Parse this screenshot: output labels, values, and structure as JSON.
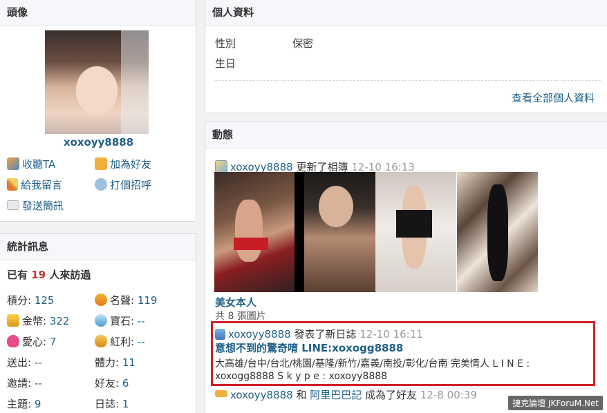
{
  "avatar_panel": {
    "title": "頭像",
    "username": "xoxoyy8888",
    "actions": [
      {
        "label": "收聽TA",
        "icon": "follow-icon"
      },
      {
        "label": "加為好友",
        "icon": "handshake-icon"
      },
      {
        "label": "給我留言",
        "icon": "pencil-icon"
      },
      {
        "label": "打個招呼",
        "icon": "chat-bubble-icon"
      },
      {
        "label": "發送簡訊",
        "icon": "envelope-icon"
      }
    ]
  },
  "stats_panel": {
    "title": "統計訊息",
    "visitors_prefix": "已有",
    "visitors_count": "19",
    "visitors_suffix": "人來訪過",
    "left": [
      {
        "label": "積分:",
        "value": "125",
        "icon": ""
      },
      {
        "label": "金幣:",
        "value": "322",
        "icon": "gold-coin-icon"
      },
      {
        "label": "愛心:",
        "value": "7",
        "icon": "heart-icon"
      },
      {
        "label": "送出:",
        "value": "--",
        "icon": ""
      },
      {
        "label": "邀請:",
        "value": "--",
        "icon": ""
      },
      {
        "label": "主題:",
        "value": "9",
        "icon": ""
      }
    ],
    "right": [
      {
        "label": "名聲:",
        "value": "119",
        "icon": "medal-icon"
      },
      {
        "label": "寶石:",
        "value": "--",
        "icon": "gem-icon"
      },
      {
        "label": "紅利:",
        "value": "--",
        "icon": "bonus-bag-icon"
      },
      {
        "label": "體力:",
        "value": "11",
        "icon": ""
      },
      {
        "label": "好友:",
        "value": "6",
        "icon": ""
      },
      {
        "label": "日誌:",
        "value": "1",
        "icon": ""
      }
    ]
  },
  "profile_panel": {
    "title": "個人資料",
    "fields": [
      {
        "label": "性別",
        "value": "保密"
      },
      {
        "label": "生日",
        "value": ""
      }
    ],
    "view_all": "查看全部個人資料"
  },
  "feed_panel": {
    "title": "動態",
    "item1": {
      "user": "xoxoyy8888",
      "action": "更新了相簿",
      "time": "12-10 16:13",
      "album_title": "美女本人",
      "album_count": "共 8 張圖片"
    },
    "item2": {
      "user": "xoxoyy8888",
      "action": "發表了新日誌",
      "time": "12-10 16:11",
      "post_title": "意想不到的驚奇唷 LINE:xoxogg8888",
      "line1": "大高雄/台中/台北/桃園/基隆/新竹/嘉義/南投/彰化/台南 完美情人 L I N E :",
      "line2": "xoxogg8888 S k y p e : xoxoyy8888"
    },
    "item3": {
      "user": "xoxoyy8888",
      "conj": "和",
      "friend": "阿里巴巴記",
      "action": "成為了好友",
      "time": "12-8 00:39"
    }
  },
  "watermark": "捷克論壇 JKForuM.Net",
  "colors": {
    "highlight_border": "#d0202a",
    "link": "#1f5f87",
    "visitor_count": "#c0392b"
  }
}
